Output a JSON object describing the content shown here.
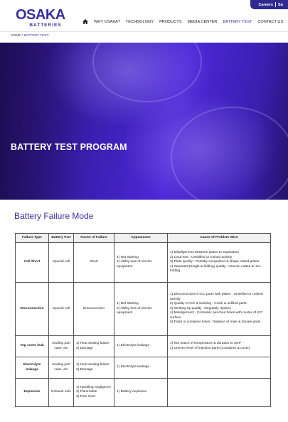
{
  "util": {
    "careers": "Careers",
    "other": "Su"
  },
  "logo": {
    "word": "OSAKA",
    "sub": "BATTERIES"
  },
  "nav": {
    "items": [
      "WHY OSAKA?",
      "TECHNOLOGY",
      "PRODUCTS",
      "MEDIA CENTER",
      "BATTERY TEST",
      "CONTACT US"
    ],
    "active_index": 4
  },
  "breadcrumb": {
    "home": "HOME",
    "sep": "/",
    "current": "BATTERY TEST"
  },
  "hero": {
    "title": "BATTERY TEST PROGRAM"
  },
  "section": {
    "title": "Battery Failure Mode"
  },
  "table": {
    "headers": [
      "Failure Type",
      "Battery Part",
      "Factor of Failure",
      "Appearance",
      "Cause of Problem Wise"
    ],
    "rows": [
      {
        "type": "Cell Short",
        "part": [
          "Special cell"
        ],
        "factor": [
          "Short"
        ],
        "appearance": [
          "1) Not Starting",
          "2) Ability loss of electric equipment"
        ],
        "cause": [
          "1) Misalignment between plates to separators",
          "2) Lead-tear : Unskilled or rushed activity",
          "3) Plate quality : Partially overpasted & shape cutted plates",
          "4) Separator(Single & folding) quality : Uneven cutted & mis-folding"
        ]
      },
      {
        "type": "Disconnection",
        "part": [
          "Special cell"
        ],
        "factor": [
          "Disconnection"
        ],
        "appearance": [
          "1) Not Starting",
          "2) Ability loss of electric equipment"
        ],
        "cause": [
          "1) Disconnected of ICC parts with plates : Unskilled or rushed activity",
          "2) Quality of ICC & bushing : Crack & unfilled parts",
          "3) Welding tip quality : Regularly replace",
          "4) Misalignment : Container punched holes with center of ICC surface",
          "5) Flash in container holes : Replace of male & female parts"
        ]
      },
      {
        "type": "Top cover leak",
        "part": [
          "Sealing part",
          "case, etc"
        ],
        "factor": [
          "1) Heat sealing failure",
          "2) Damage"
        ],
        "appearance": [
          "1) Electrolyte leakage"
        ],
        "cause": [
          "1) Not match of temperature & duration to SOP",
          "2) Uneven level of injection parts (Container & cover)"
        ]
      },
      {
        "type": "Electrolyte leakage",
        "part": [
          "Sealing part",
          "case, etc"
        ],
        "factor": [
          "1) Heat sealing failure",
          "2) Damage"
        ],
        "appearance": [
          "1) Electrolyte leakage"
        ],
        "cause": []
      },
      {
        "type": "Explosion",
        "part": [
          "Exhaust hole"
        ],
        "factor": [
          "1) Handling negligence",
          "2) Flammable",
          "3) Pole short"
        ],
        "appearance": [
          "1) Battery explosion"
        ],
        "cause": []
      }
    ]
  }
}
